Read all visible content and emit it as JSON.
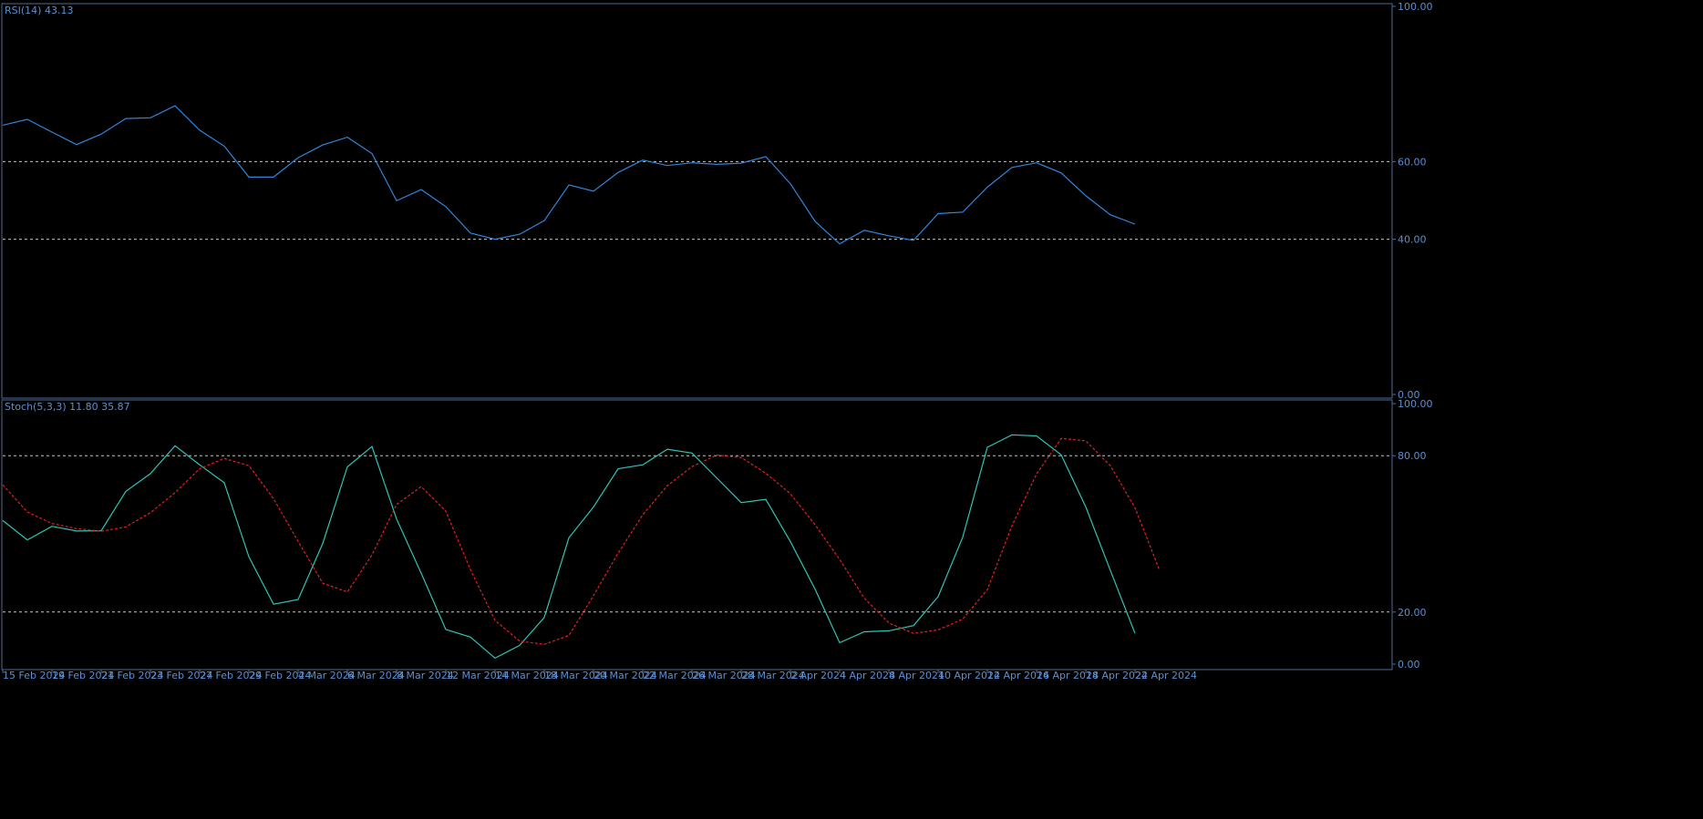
{
  "chart_data": {
    "type": "line",
    "dates": [
      "15 Feb 2024",
      "19 Feb 2024",
      "21 Feb 2024",
      "23 Feb 2024",
      "27 Feb 2024",
      "29 Feb 2024",
      "4 Mar 2024",
      "6 Mar 2024",
      "8 Mar 2024",
      "12 Mar 2024",
      "14 Mar 2024",
      "18 Mar 2024",
      "20 Mar 2024",
      "22 Mar 2024",
      "26 Mar 2024",
      "28 Mar 2024",
      "2 Apr 2024",
      "4 Apr 2024",
      "8 Apr 2024",
      "10 Apr 2024",
      "12 Apr 2024",
      "16 Apr 2024",
      "18 Apr 2024",
      "22 Apr 2024"
    ],
    "x_step_per_label": 2,
    "colors": {
      "background": "#000000",
      "frame": "#4d6b94",
      "text": "#5b8fd0",
      "grid": "#c8c8c8",
      "rsi": "#2f86dc",
      "stoch_main": "#2ec4b6",
      "stoch_signal": "#e02020"
    },
    "panels": [
      {
        "id": "rsi",
        "label": "RSI(14) 43.13",
        "ylim": [
          0,
          100
        ],
        "yticks": [
          "100.00",
          "60.00",
          "40.00",
          "0.00"
        ],
        "ytick_values": [
          100,
          60,
          40,
          0
        ],
        "levels": [
          60,
          40
        ],
        "series": [
          {
            "values": [
              69.4,
              70.9,
              67.6,
              64.4,
              67.1,
              71.1,
              71.3,
              74.4,
              68.1,
              64.0,
              56.0,
              56.0,
              61.0,
              64.3,
              66.3,
              62.1,
              49.9,
              52.8,
              48.4,
              41.6,
              40.0,
              41.3,
              44.8,
              54.0,
              52.4,
              57.2,
              60.4,
              59.0,
              59.7,
              59.3,
              59.6,
              61.3,
              54.3,
              44.6,
              38.8,
              42.3,
              40.9,
              39.7,
              46.6,
              47.0,
              53.4,
              58.5,
              59.7,
              57.1,
              51.2,
              46.3,
              43.9
            ]
          }
        ]
      },
      {
        "id": "stoch",
        "label": "Stoch(5,3,3) 11.80 35.87",
        "ylim": [
          0,
          100
        ],
        "yticks": [
          "100.00",
          "80.00",
          "20.00",
          "0.00"
        ],
        "ytick_values": [
          100,
          80,
          20,
          0
        ],
        "levels": [
          80,
          20
        ],
        "series": [
          {
            "values": [
              55.1,
              47.7,
              52.9,
              51.1,
              51.2,
              66.3,
              73.1,
              83.8,
              76.5,
              69.6,
              41.2,
              23.0,
              24.8,
              46.3,
              75.7,
              83.5,
              55.7,
              34.9,
              13.3,
              10.4,
              2.3,
              7.2,
              17.9,
              48.5,
              60.3,
              75.0,
              76.5,
              82.5,
              81.0,
              71.5,
              62.0,
              63.2,
              47.0,
              28.8,
              8.2,
              12.4,
              12.8,
              14.8,
              25.9,
              48.7,
              83.2,
              88.0,
              87.6,
              80.3,
              60.3,
              35.9,
              11.8
            ]
          },
          {
            "dashed": true,
            "values": [
              68.8,
              58.4,
              54.0,
              52.0,
              51.0,
              52.7,
              58.1,
              65.8,
              75.0,
              78.9,
              76.2,
              63.5,
              47.1,
              31.1,
              27.7,
              41.9,
              61.3,
              68.1,
              58.7,
              36.3,
              16.8,
              8.8,
              7.6,
              11.0,
              26.3,
              42.6,
              57.3,
              68.5,
              75.8,
              80.2,
              79.3,
              73.3,
              65.4,
              53.5,
              40.2,
              25.3,
              15.8,
              11.8,
              13.1,
              17.3,
              28.6,
              53.1,
              73.0,
              86.6,
              85.7,
              76.1,
              60.0,
              35.9
            ]
          }
        ]
      }
    ]
  }
}
